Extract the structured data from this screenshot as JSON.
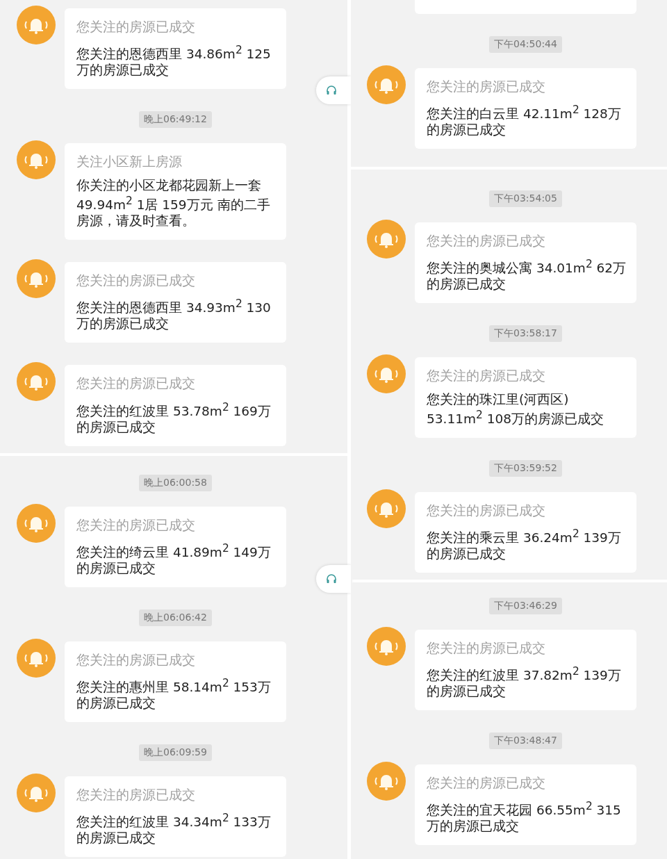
{
  "columns": [
    {
      "panels": [
        {
          "service_button": true,
          "items": [
            {
              "kind": "message",
              "title": "您关注的房源已成交",
              "body": "您关注的恩德西里 34.86m$^{2}$ 125万的房源已成交"
            },
            {
              "kind": "time",
              "text": "晚上06:49:12"
            },
            {
              "kind": "message",
              "title": "关注小区新上房源",
              "body": "你关注的小区龙都花园新上一套49.94m$^{2}$ 1居 159万元 南的二手房源，请及时查看。"
            },
            {
              "kind": "message",
              "title": "您关注的房源已成交",
              "body": "您关注的恩德西里 34.93m$^{2}$ 130万的房源已成交"
            },
            {
              "kind": "message",
              "title": "您关注的房源已成交",
              "body": "您关注的红波里 53.78m$^{2}$ 169万的房源已成交"
            }
          ]
        },
        {
          "service_button": true,
          "items": [
            {
              "kind": "time",
              "text": "晚上06:00:58"
            },
            {
              "kind": "message",
              "title": "您关注的房源已成交",
              "body": "您关注的绮云里 41.89m$^{2}$ 149万的房源已成交"
            },
            {
              "kind": "time",
              "text": "晚上06:06:42"
            },
            {
              "kind": "message",
              "title": "您关注的房源已成交",
              "body": "您关注的惠州里 58.14m$^{2}$ 153万的房源已成交"
            },
            {
              "kind": "time",
              "text": "晚上06:09:59"
            },
            {
              "kind": "message",
              "title": "您关注的房源已成交",
              "body": "您关注的红波里 34.34m$^{2}$ 133万的房源已成交"
            }
          ]
        }
      ]
    },
    {
      "panels": [
        {
          "service_button": false,
          "items": [
            {
              "kind": "cut"
            },
            {
              "kind": "time",
              "text": "下午04:50:44"
            },
            {
              "kind": "message",
              "title": "您关注的房源已成交",
              "body": "您关注的白云里 42.11m$^{2}$ 128万的房源已成交"
            }
          ]
        },
        {
          "service_button": false,
          "items": [
            {
              "kind": "time",
              "text": "下午03:54:05"
            },
            {
              "kind": "message",
              "title": "您关注的房源已成交",
              "body": "您关注的奥城公寓 34.01m$^{2}$ 62万的房源已成交"
            },
            {
              "kind": "time",
              "text": "下午03:58:17"
            },
            {
              "kind": "message",
              "title": "您关注的房源已成交",
              "body": "您关注的珠江里(河西区) 53.11m$^{2}$ 108万的房源已成交"
            },
            {
              "kind": "time",
              "text": "下午03:59:52"
            },
            {
              "kind": "message",
              "title": "您关注的房源已成交",
              "body": "您关注的乘云里 36.24m$^{2}$ 139万的房源已成交"
            }
          ]
        },
        {
          "service_button": false,
          "items": [
            {
              "kind": "time",
              "text": "下午03:46:29"
            },
            {
              "kind": "message",
              "title": "您关注的房源已成交",
              "body": "您关注的红波里 37.82m$^{2}$ 139万的房源已成交"
            },
            {
              "kind": "time",
              "text": "下午03:48:47"
            },
            {
              "kind": "message",
              "title": "您关注的房源已成交",
              "body": "您关注的宜天花园 66.55m$^{2}$ 315万的房源已成交"
            }
          ]
        }
      ]
    }
  ]
}
